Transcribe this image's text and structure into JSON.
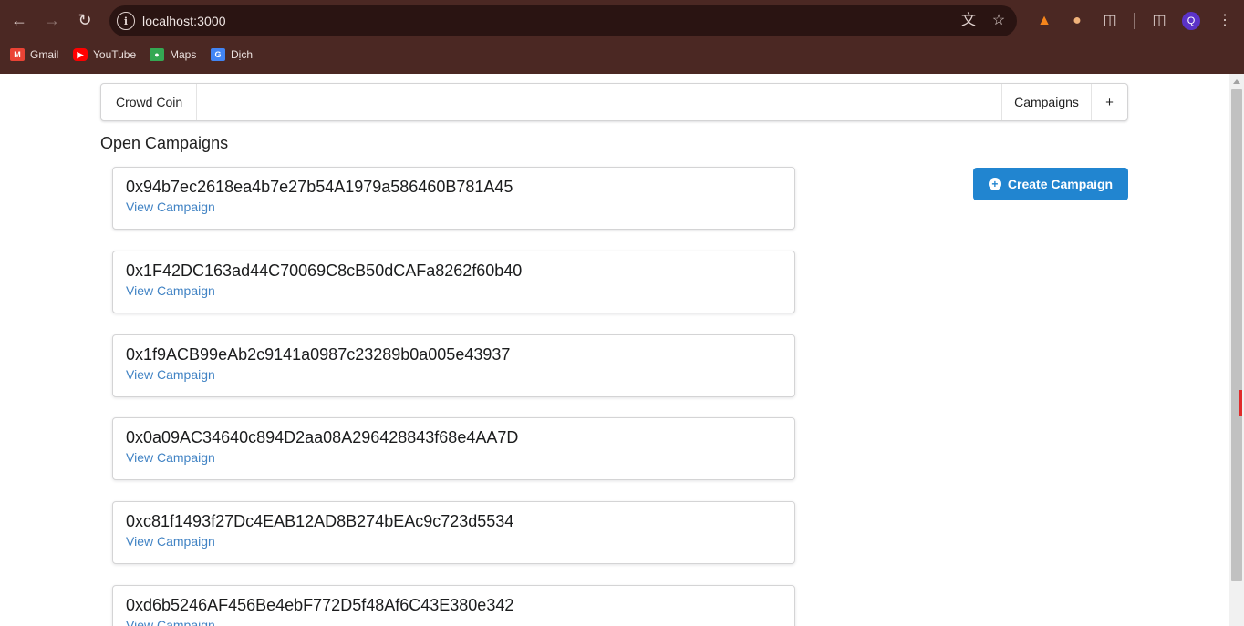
{
  "browser": {
    "url": "localhost:3000",
    "profile_initial": "Q",
    "bookmarks": [
      {
        "label": "Gmail",
        "icon": "gmail-icon",
        "color": "#ea4335"
      },
      {
        "label": "YouTube",
        "icon": "youtube-icon",
        "color": "#ff0000"
      },
      {
        "label": "Maps",
        "icon": "maps-icon",
        "color": "#34a853"
      },
      {
        "label": "Dịch",
        "icon": "translate-icon",
        "color": "#4285f4"
      }
    ]
  },
  "menu": {
    "brand": "Crowd Coin",
    "campaigns": "Campaigns",
    "add": "+"
  },
  "page": {
    "heading": "Open Campaigns",
    "create_button": "Create Campaign"
  },
  "campaigns": [
    {
      "address": "0x94b7ec2618ea4b7e27b54A1979a586460B781A45",
      "link": "View Campaign"
    },
    {
      "address": "0x1F42DC163ad44C70069C8cB50dCAFa8262f60b40",
      "link": "View Campaign"
    },
    {
      "address": "0x1f9ACB99eAb2c9141a0987c23289b0a005e43937",
      "link": "View Campaign"
    },
    {
      "address": "0x0a09AC34640c894D2aa08A296428843f68e4AA7D",
      "link": "View Campaign"
    },
    {
      "address": "0xc81f1493f27Dc4EAB12AD8B274bEAc9c723d5534",
      "link": "View Campaign"
    },
    {
      "address": "0xd6b5246AF456Be4ebF772D5f48Af6C43E380e342",
      "link": "View Campaign"
    }
  ],
  "colors": {
    "chrome": "#4b2823",
    "accent": "#2185d0",
    "link": "#4183c4"
  }
}
